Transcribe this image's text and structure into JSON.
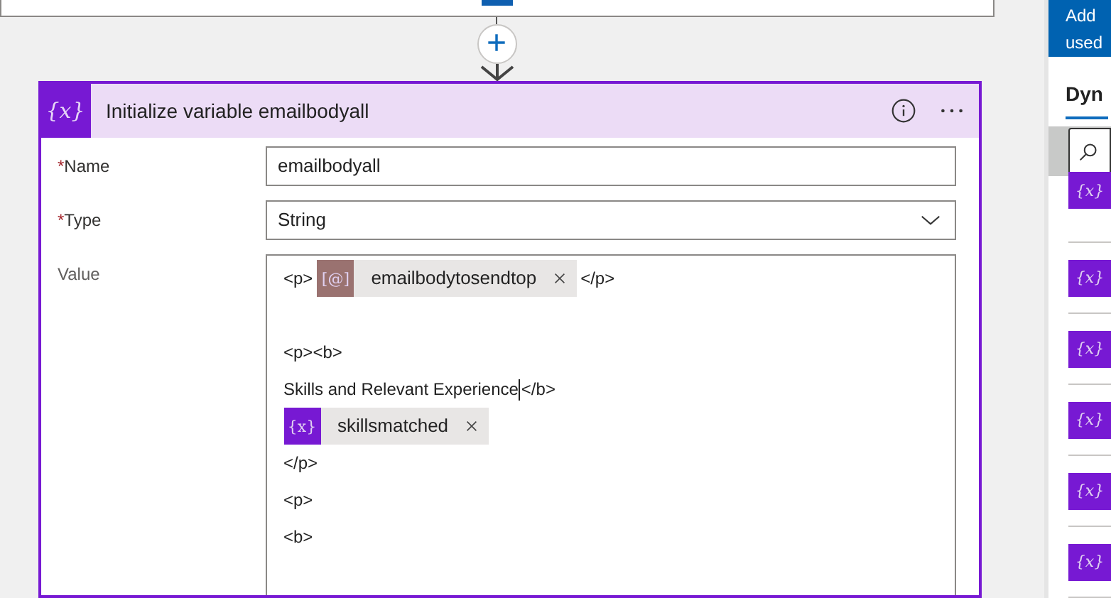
{
  "connector": {
    "add_button": "+"
  },
  "action_card": {
    "icon": "{x}",
    "title": "Initialize variable emailbodyall",
    "fields": [
      {
        "kind": "input",
        "label": "Name",
        "required_mark": "*",
        "value": "emailbodyall"
      },
      {
        "kind": "select",
        "label": "Type",
        "required_mark": "*",
        "value": "String"
      },
      {
        "kind": "editor",
        "label": "Value",
        "lines": [
          {
            "kind": "line",
            "segments": [
              {
                "kind": "text",
                "text": "<p>"
              },
              {
                "kind": "token",
                "glyph": "[@]",
                "color": "#9a7270",
                "text": "emailbodytosendtop"
              },
              {
                "kind": "text",
                "text": "</p>"
              }
            ]
          },
          {
            "kind": "blank"
          },
          {
            "kind": "line",
            "segments": [
              {
                "kind": "text",
                "text": "<p><b>"
              }
            ]
          },
          {
            "kind": "line",
            "segments": [
              {
                "kind": "text",
                "text": "Skills and Relevant Experience"
              },
              {
                "kind": "caret"
              },
              {
                "kind": "text",
                "text": "</b>"
              }
            ]
          },
          {
            "kind": "line",
            "segments": [
              {
                "kind": "token",
                "glyph": "{x}",
                "color": "#7719d3",
                "text": "skillsmatched"
              }
            ]
          },
          {
            "kind": "line",
            "segments": [
              {
                "kind": "text",
                "text": "</p>"
              }
            ]
          },
          {
            "kind": "line",
            "segments": [
              {
                "kind": "text",
                "text": "<p>"
              }
            ]
          },
          {
            "kind": "line",
            "segments": [
              {
                "kind": "text",
                "text": "<b>"
              }
            ]
          }
        ]
      }
    ]
  },
  "side_panel": {
    "header_lines": [
      "Add",
      "used"
    ],
    "tab": "Dyn",
    "items": [
      {
        "glyph": "{x}"
      },
      {
        "glyph": "{x}"
      },
      {
        "glyph": "{x}"
      },
      {
        "glyph": "{x}"
      },
      {
        "glyph": "{x}"
      },
      {
        "glyph": "{x}"
      }
    ]
  }
}
